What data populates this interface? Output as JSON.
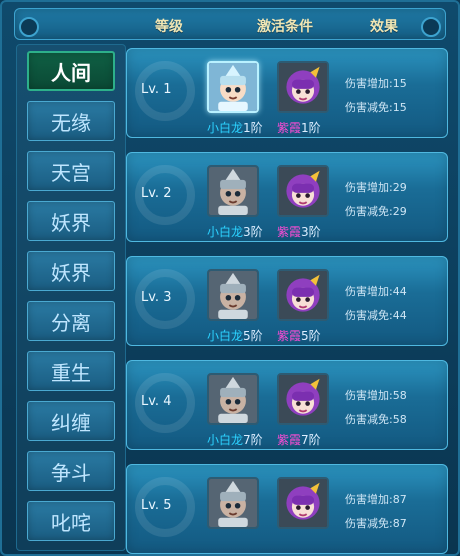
{
  "header": {
    "level": "等级",
    "condition": "激活条件",
    "effect": "效果"
  },
  "tabs": [
    {
      "label": "人间",
      "active": true
    },
    {
      "label": "无缘",
      "active": false
    },
    {
      "label": "天宫",
      "active": false
    },
    {
      "label": "妖界",
      "active": false
    },
    {
      "label": "妖界",
      "active": false
    },
    {
      "label": "分离",
      "active": false
    },
    {
      "label": "重生",
      "active": false
    },
    {
      "label": "纠缠",
      "active": false
    },
    {
      "label": "争斗",
      "active": false
    },
    {
      "label": "叱咤",
      "active": false
    }
  ],
  "levels": [
    {
      "level": "Lv. 1",
      "req1_name": "小白龙",
      "req1_suf": "1阶",
      "req2_name": "紫霞",
      "req2_suf": "1阶",
      "stat1": "伤害增加:15",
      "stat2": "伤害减免:15"
    },
    {
      "level": "Lv. 2",
      "req1_name": "小白龙",
      "req1_suf": "3阶",
      "req2_name": "紫霞",
      "req2_suf": "3阶",
      "stat1": "伤害增加:29",
      "stat2": "伤害减免:29"
    },
    {
      "level": "Lv. 3",
      "req1_name": "小白龙",
      "req1_suf": "5阶",
      "req2_name": "紫霞",
      "req2_suf": "5阶",
      "stat1": "伤害增加:44",
      "stat2": "伤害减免:44"
    },
    {
      "level": "Lv. 4",
      "req1_name": "小白龙",
      "req1_suf": "7阶",
      "req2_name": "紫霞",
      "req2_suf": "7阶",
      "stat1": "伤害增加:58",
      "stat2": "伤害减免:58"
    },
    {
      "level": "Lv. 5",
      "req1_name": "",
      "req1_suf": "",
      "req2_name": "",
      "req2_suf": "",
      "stat1": "伤害增加:87",
      "stat2": "伤害减免:87"
    }
  ]
}
